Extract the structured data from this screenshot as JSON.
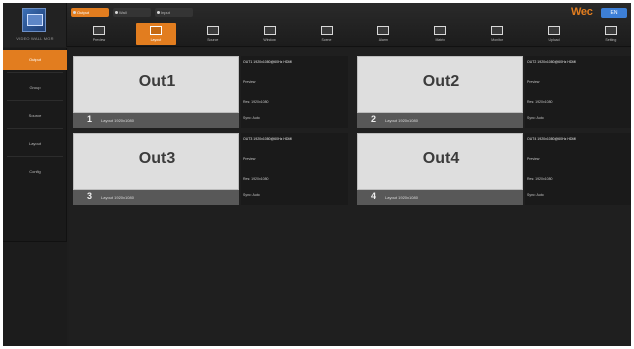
{
  "app": {
    "logo_caption": "VIDEO WALL MGR",
    "brand": "Wec",
    "brand_button": "EN"
  },
  "mode_tabs": [
    {
      "label": "Output",
      "active": true
    },
    {
      "label": "Wall",
      "active": false
    },
    {
      "label": "Input",
      "active": false
    }
  ],
  "toolbar": [
    {
      "label": "Preview",
      "icon": "monitor-icon",
      "active": false
    },
    {
      "label": "Layout",
      "icon": "layout-icon",
      "active": true
    },
    {
      "label": "Source",
      "icon": "source-icon",
      "active": false
    },
    {
      "label": "Window",
      "icon": "window-icon",
      "active": false
    },
    {
      "label": "Scene",
      "icon": "scene-icon",
      "active": false
    },
    {
      "label": "Alarm",
      "icon": "alarm-icon",
      "active": false
    },
    {
      "label": "Matrix",
      "icon": "matrix-icon",
      "active": false
    },
    {
      "label": "Monitor",
      "icon": "display-icon",
      "active": false
    },
    {
      "label": "Upload",
      "icon": "upload-icon",
      "active": false
    },
    {
      "label": "Setting",
      "icon": "settings-icon",
      "active": false
    }
  ],
  "sidebar": [
    {
      "label": "Output",
      "active": true
    },
    {
      "label": "Group",
      "active": false
    },
    {
      "label": "Source",
      "active": false
    },
    {
      "label": "Layout",
      "active": false
    },
    {
      "label": "Config",
      "active": false
    }
  ],
  "outputs": [
    {
      "name": "Out1",
      "number": "1",
      "footer": "Layout 1920x1080",
      "info": {
        "title": "OUT1 1920x1080@60Hz HDMI",
        "l1": "Preview",
        "l2": "Res: 1920x1080",
        "l3": "Sync: Auto"
      }
    },
    {
      "name": "Out2",
      "number": "2",
      "footer": "Layout 1920x1080",
      "info": {
        "title": "OUT2 1920x1080@60Hz HDMI",
        "l1": "Preview",
        "l2": "Res: 1920x1080",
        "l3": "Sync: Auto"
      }
    },
    {
      "name": "Out3",
      "number": "3",
      "footer": "Layout 1920x1080",
      "info": {
        "title": "OUT3 1920x1080@60Hz HDMI",
        "l1": "Preview",
        "l2": "Res: 1920x1080",
        "l3": "Sync: Auto"
      }
    },
    {
      "name": "Out4",
      "number": "4",
      "footer": "Layout 1920x1080",
      "info": {
        "title": "OUT4 1920x1080@60Hz HDMI",
        "l1": "Preview",
        "l2": "Res: 1920x1080",
        "l3": "Sync: Auto"
      }
    }
  ],
  "colors": {
    "accent": "#e27d1f",
    "brand_button": "#3d7fd6",
    "background": "#1e1e1e"
  }
}
